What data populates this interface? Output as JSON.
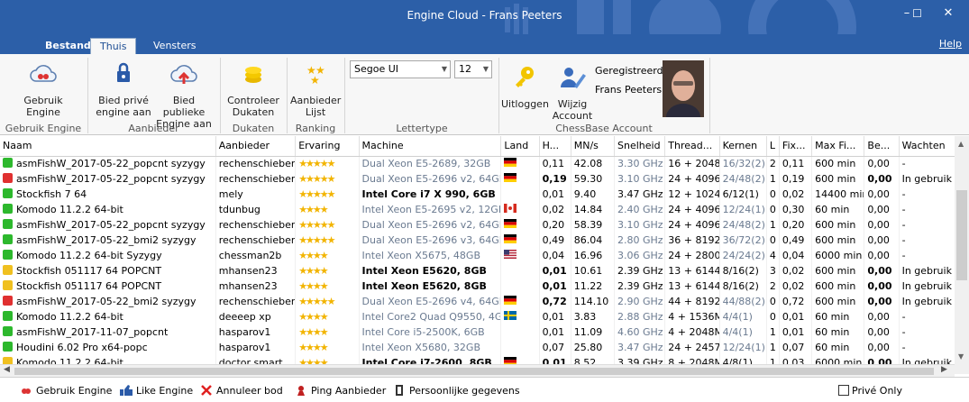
{
  "window": {
    "title": "Engine Cloud - Frans Peeters",
    "min": "–",
    "max": "☐",
    "close": "✕"
  },
  "tabs": {
    "bestand": "Bestand",
    "thuis": "Thuis",
    "vensters": "Vensters",
    "help": "Help"
  },
  "ribbon": {
    "gebruik": "Gebruik\nEngine",
    "gebruik_group": "Gebruik Engine",
    "bied_prive": "Bied privé\nengine aan",
    "bied_publiek": "Bied publieke\nEngine aan",
    "aanbieder_group": "Aanbieder",
    "controleer": "Controleer\nDukaten",
    "dukaten_group": "Dukaten",
    "lijst": "Aanbieder\nLijst",
    "ranking_group": "Ranking",
    "font": "Segoe UI",
    "size": "12",
    "lettertype_group": "Lettertype",
    "uitloggen": "Uitloggen",
    "wijzig": "Wijzig\nAccount",
    "geregistreerd": "Geregistreerd",
    "user": "Frans Peeters",
    "account_group": "ChessBase Account"
  },
  "columns": [
    "Naam",
    "Aanbieder",
    "Ervaring",
    "Machine",
    "Land",
    "H...",
    "MN/s",
    "Snelheid",
    "Thread...",
    "Kernen",
    "L",
    "Fix...",
    "Max Fi...",
    "Be...",
    "Wachten"
  ],
  "rows": [
    {
      "c": "#2db82d",
      "naam": "asmFishW_2017-05-22_popcnt syzygy",
      "aanb": "rechenschieber",
      "stars": "★★★★★",
      "machine": "Dual Xeon E5-2689, 32GB",
      "mdim": true,
      "land": "de",
      "h": "0,11",
      "mns": "42.08",
      "snel": "3.30 GHz",
      "thr": "16 + 2048I",
      "kern": "16/32(2)",
      "l": "2",
      "fix": "0,11",
      "max": "600 min",
      "be": "0,00",
      "wacht": "-",
      "hb": false,
      "beb": false
    },
    {
      "c": "#e03030",
      "naam": "asmFishW_2017-05-22_popcnt syzygy",
      "aanb": "rechenschieber",
      "stars": "★★★★★",
      "machine": "Dual Xeon E5-2696 v2, 64GB",
      "mdim": true,
      "land": "de",
      "h": "0,19",
      "mns": "59.30",
      "snel": "3.10 GHz",
      "thr": "24 + 4096I",
      "kern": "24/48(2)",
      "l": "1",
      "fix": "0,19",
      "max": "600 min",
      "be": "0,00",
      "wacht": "In gebruik",
      "hb": true,
      "beb": true
    },
    {
      "c": "#2db82d",
      "naam": "Stockfish 7 64",
      "aanb": "mely",
      "stars": "★★★★★",
      "machine": "Intel Core i7 X 990,  6GB",
      "mdim": false,
      "land": "",
      "h": "0,01",
      "mns": "9.40",
      "snel": "3.47 GHz",
      "thr": "12 + 1024I",
      "kern": "6/12(1)",
      "l": "0",
      "fix": "0,02",
      "max": "14400 min",
      "be": "0,00",
      "wacht": "-",
      "hb": false,
      "beb": false
    },
    {
      "c": "#2db82d",
      "naam": "Komodo 11.2.2 64-bit",
      "aanb": "tdunbug",
      "stars": "★★★★",
      "machine": "Intel Xeon E5-2695 v2,  12GB",
      "mdim": true,
      "land": "ca",
      "h": "0,02",
      "mns": "14.84",
      "snel": "2.40 GHz",
      "thr": "24 + 4096I",
      "kern": "12/24(1)",
      "l": "0",
      "fix": "0,30",
      "max": "60 min",
      "be": "0,00",
      "wacht": "-",
      "hb": false,
      "beb": false
    },
    {
      "c": "#2db82d",
      "naam": "asmFishW_2017-05-22_popcnt syzygy",
      "aanb": "rechenschieber",
      "stars": "★★★★★",
      "machine": "Dual Xeon E5-2696 v2,  64GB",
      "mdim": true,
      "land": "de",
      "h": "0,20",
      "mns": "58.39",
      "snel": "3.10 GHz",
      "thr": "24 + 4096I",
      "kern": "24/48(2)",
      "l": "1",
      "fix": "0,20",
      "max": "600 min",
      "be": "0,00",
      "wacht": "-",
      "hb": false,
      "beb": false
    },
    {
      "c": "#2db82d",
      "naam": "asmFishW_2017-05-22_bmi2  syzygy",
      "aanb": "rechenschieber",
      "stars": "★★★★★",
      "machine": "Dual Xeon E5-2696 v3,  64GB",
      "mdim": true,
      "land": "de",
      "h": "0,49",
      "mns": "86.04",
      "snel": "2.80 GHz",
      "thr": "36 + 8192I",
      "kern": "36/72(2)",
      "l": "0",
      "fix": "0,49",
      "max": "600 min",
      "be": "0,00",
      "wacht": "-",
      "hb": false,
      "beb": false
    },
    {
      "c": "#2db82d",
      "naam": "Komodo 11.2.2 64-bit Syzygy",
      "aanb": "chessman2b",
      "stars": "★★★★",
      "machine": "Intel Xeon X5675,  48GB",
      "mdim": true,
      "land": "us",
      "h": "0,04",
      "mns": "16.96",
      "snel": "3.06 GHz",
      "thr": "24 + 28000",
      "kern": "24/24(2)",
      "l": "4",
      "fix": "0,04",
      "max": "6000 min",
      "be": "0,00",
      "wacht": "-",
      "hb": false,
      "beb": false
    },
    {
      "c": "#f0c020",
      "naam": "Stockfish 051117 64 POPCNT",
      "aanb": "mhansen23",
      "stars": "★★★★",
      "machine": "Intel Xeon E5620,  8GB",
      "mdim": false,
      "land": "",
      "h": "0,01",
      "mns": "10.61",
      "snel": "2.39 GHz",
      "thr": "13 + 6144I",
      "kern": "8/16(2)",
      "l": "3",
      "fix": "0,02",
      "max": "600 min",
      "be": "0,00",
      "wacht": "In gebruik",
      "hb": true,
      "beb": true
    },
    {
      "c": "#f0c020",
      "naam": "Stockfish 051117 64 POPCNT",
      "aanb": "mhansen23",
      "stars": "★★★★",
      "machine": "Intel Xeon E5620,  8GB",
      "mdim": false,
      "land": "",
      "h": "0,01",
      "mns": "11.22",
      "snel": "2.39 GHz",
      "thr": "13 + 6144I",
      "kern": "8/16(2)",
      "l": "2",
      "fix": "0,02",
      "max": "600 min",
      "be": "0,00",
      "wacht": "In gebruik",
      "hb": true,
      "beb": true
    },
    {
      "c": "#e03030",
      "naam": "asmFishW_2017-05-22_bmi2 syzygy",
      "aanb": "rechenschieber",
      "stars": "★★★★★",
      "machine": "Dual Xeon E5-2696 v4,  64GB",
      "mdim": true,
      "land": "de",
      "h": "0,72",
      "mns": "114.10",
      "snel": "2.90 GHz",
      "thr": "44 + 8192I",
      "kern": "44/88(2)",
      "l": "0",
      "fix": "0,72",
      "max": "600 min",
      "be": "0,00",
      "wacht": "In gebruik",
      "hb": true,
      "beb": true
    },
    {
      "c": "#2db82d",
      "naam": "Komodo 11.2.2 64-bit",
      "aanb": "deeeep xp",
      "stars": "★★★★",
      "machine": "Intel Core2 Quad Q9550,  4GE",
      "mdim": true,
      "land": "se",
      "h": "0,01",
      "mns": "3.83",
      "snel": "2.88 GHz",
      "thr": "4 + 1536M",
      "kern": "4/4(1)",
      "l": "0",
      "fix": "0,01",
      "max": "60 min",
      "be": "0,00",
      "wacht": "-",
      "hb": false,
      "beb": false
    },
    {
      "c": "#2db82d",
      "naam": "asmFishW_2017-11-07_popcnt",
      "aanb": "hasparov1",
      "stars": "★★★★",
      "machine": "Intel Core i5-2500K,  6GB",
      "mdim": true,
      "land": "",
      "h": "0,01",
      "mns": "11.09",
      "snel": "4.60 GHz",
      "thr": "4 + 2048M",
      "kern": "4/4(1)",
      "l": "1",
      "fix": "0,01",
      "max": "60 min",
      "be": "0,00",
      "wacht": "-",
      "hb": false,
      "beb": false
    },
    {
      "c": "#2db82d",
      "naam": "Houdini 6.02 Pro x64-popc",
      "aanb": "hasparov1",
      "stars": "★★★★",
      "machine": "Intel Xeon X5680,  32GB",
      "mdim": true,
      "land": "",
      "h": "0,07",
      "mns": "25.80",
      "snel": "3.47 GHz",
      "thr": "24 + 2457(",
      "kern": "12/24(1)",
      "l": "1",
      "fix": "0,07",
      "max": "60 min",
      "be": "0,00",
      "wacht": "-",
      "hb": false,
      "beb": false
    },
    {
      "c": "#f0c020",
      "naam": "Komodo 11.2.2 64-bit",
      "aanb": "doctor smart",
      "stars": "★★★★",
      "machine": "Intel Core i7-2600,  8GB",
      "mdim": false,
      "land": "de",
      "h": "0,01",
      "mns": "8.52",
      "snel": "3.39 GHz",
      "thr": "8 + 2048M",
      "kern": "4/8(1)",
      "l": "1",
      "fix": "0,03",
      "max": "6000 min",
      "be": "0,00",
      "wacht": "In gebruik",
      "hb": true,
      "beb": true
    }
  ],
  "status": {
    "gebruik": "Gebruik Engine",
    "like": "Like Engine",
    "annuleer": "Annuleer bod",
    "ping": "Ping Aanbieder",
    "pers": "Persoonlijke gegevens",
    "prive": "Privé Only"
  }
}
